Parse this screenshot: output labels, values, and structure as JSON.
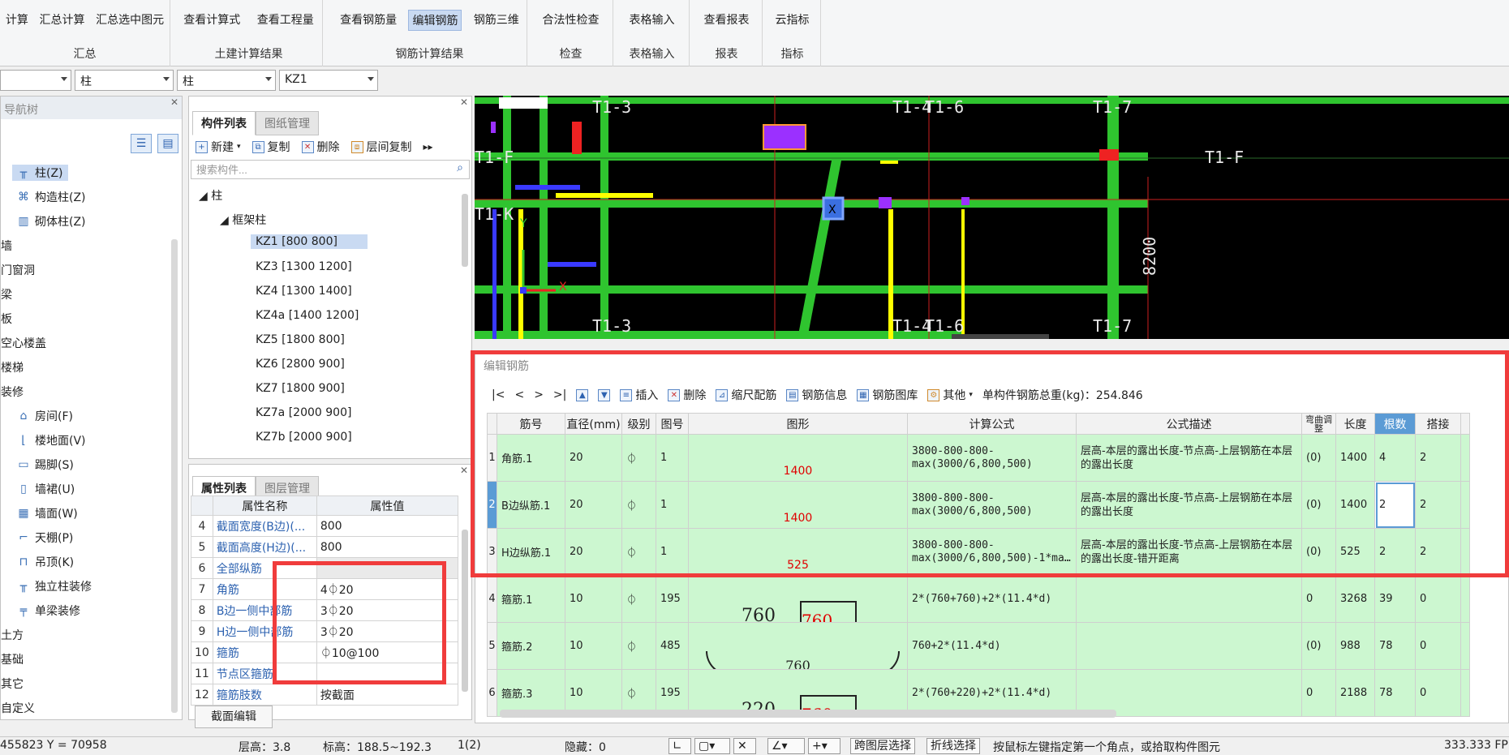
{
  "ribbon": {
    "groups": [
      {
        "label": "汇总",
        "buttons": [
          "计算",
          "汇总计算",
          "汇总选中图元"
        ]
      },
      {
        "label": "土建计算结果",
        "buttons": [
          "查看计算式",
          "查看工程量"
        ]
      },
      {
        "label": "钢筋计算结果",
        "buttons": [
          "查看钢筋量",
          "编辑钢筋",
          "钢筋三维"
        ]
      },
      {
        "label": "检查",
        "buttons": [
          "合法性检查"
        ]
      },
      {
        "label": "表格输入",
        "buttons": [
          "表格输入"
        ]
      },
      {
        "label": "报表",
        "buttons": [
          "查看报表"
        ]
      },
      {
        "label": "指标",
        "buttons": [
          "云指标"
        ]
      }
    ],
    "active_button": "编辑钢筋"
  },
  "selectors": [
    "柱",
    "柱",
    "KZ1"
  ],
  "nav": {
    "title": "导航树",
    "items": [
      "柱(Z)",
      "构造柱(Z)",
      "砌体柱(Z)",
      "墙",
      "门窗洞",
      "梁",
      "板",
      "空心楼盖",
      "楼梯",
      "装修",
      "房间(F)",
      "楼地面(V)",
      "踢脚(S)",
      "墙裙(U)",
      "墙面(W)",
      "天棚(P)",
      "吊顶(K)",
      "独立柱装修",
      "单梁装修",
      "土方",
      "基础",
      "其它",
      "自定义"
    ]
  },
  "components": {
    "tabs": [
      "构件列表",
      "图纸管理"
    ],
    "toolbar": [
      "新建",
      "复制",
      "删除",
      "层间复制"
    ],
    "search_placeholder": "搜索构件...",
    "root": "柱",
    "group": "框架柱",
    "items": [
      "KZ1 [800 800]",
      "KZ3 [1300 1200]",
      "KZ4 [1300 1400]",
      "KZ4a [1400 1200]",
      "KZ5 [1800 800]",
      "KZ6 [2800 900]",
      "KZ7 [1800 900]",
      "KZ7a [2000 900]",
      "KZ7b [2000 900]"
    ]
  },
  "properties": {
    "tabs": [
      "属性列表",
      "图层管理"
    ],
    "headers": [
      "属性名称",
      "属性值"
    ],
    "rows": [
      {
        "idx": "4",
        "name": "截面宽度(B边)(...",
        "value": "800"
      },
      {
        "idx": "5",
        "name": "截面高度(H边)(...",
        "value": "800"
      },
      {
        "idx": "6",
        "name": "全部纵筋",
        "value": ""
      },
      {
        "idx": "7",
        "name": "角筋",
        "value": "4⏀20"
      },
      {
        "idx": "8",
        "name": "B边一侧中部筋",
        "value": "3⏀20"
      },
      {
        "idx": "9",
        "name": "H边一侧中部筋",
        "value": "3⏀20"
      },
      {
        "idx": "10",
        "name": "箍筋",
        "value": "⏀10@100"
      },
      {
        "idx": "11",
        "name": "节点区箍筋",
        "value": ""
      },
      {
        "idx": "12",
        "name": "箍筋肢数",
        "value": "按截面"
      }
    ],
    "edit_button": "截面编辑"
  },
  "cad": {
    "labels": [
      "T1-3",
      "T1-4",
      "T1-6",
      "T1-7",
      "T1-F",
      "T1-F",
      "T1-K",
      "T1-3",
      "T1-4",
      "T1-6",
      "T1-7",
      "8200",
      "Y",
      "X"
    ]
  },
  "rebar": {
    "title": "编辑钢筋",
    "toolbar": [
      "|<",
      "<",
      ">",
      ">|",
      "插入",
      "删除",
      "缩尺配筋",
      "钢筋信息",
      "钢筋图库",
      "其他"
    ],
    "total_weight": "单构件钢筋总重(kg)：254.846",
    "headers": [
      "筋号",
      "直径(mm)",
      "级别",
      "图号",
      "图形",
      "计算公式",
      "公式描述",
      "弯曲调整",
      "长度",
      "根数",
      "搭接"
    ],
    "rows": [
      {
        "num": "1",
        "name": "角筋.1",
        "dia": "20",
        "grade": "⏀",
        "fig": "1",
        "shape": "1400",
        "formula1": "3800-800-800-",
        "formula2": "max(3000/6,800,500)",
        "desc": "层高-本层的露出长度-节点高-上层钢筋在本层的露出长度",
        "bend": "(0)",
        "length": "1400",
        "count": "4",
        "lap": "2"
      },
      {
        "num": "2",
        "name": "B边纵筋.1",
        "dia": "20",
        "grade": "⏀",
        "fig": "1",
        "shape": "1400",
        "formula1": "3800-800-800-",
        "formula2": "max(3000/6,800,500)",
        "desc": "层高-本层的露出长度-节点高-上层钢筋在本层的露出长度",
        "bend": "(0)",
        "length": "1400",
        "count": "2",
        "lap": "2"
      },
      {
        "num": "3",
        "name": "H边纵筋.1",
        "dia": "20",
        "grade": "⏀",
        "fig": "1",
        "shape": "525",
        "formula1": "3800-800-800-",
        "formula2": "max(3000/6,800,500)-1*ma…",
        "desc": "层高-本层的露出长度-节点高-上层钢筋在本层的露出长度-错开距离",
        "bend": "(0)",
        "length": "525",
        "count": "2",
        "lap": "2"
      },
      {
        "num": "4",
        "name": "箍筋.1",
        "dia": "10",
        "grade": "⏀",
        "fig": "195",
        "shape_a": "760",
        "shape_b": "760",
        "formula1": "2*(760+760)+2*(11.4*d)",
        "formula2": "",
        "desc": "",
        "bend": "0",
        "length": "3268",
        "count": "39",
        "lap": "0"
      },
      {
        "num": "5",
        "name": "箍筋.2",
        "dia": "10",
        "grade": "⏀",
        "fig": "485",
        "shape_a": "760",
        "formula1": "760+2*(11.4*d)",
        "formula2": "",
        "desc": "",
        "bend": "(0)",
        "length": "988",
        "count": "78",
        "lap": "0"
      },
      {
        "num": "6",
        "name": "箍筋.3",
        "dia": "10",
        "grade": "⏀",
        "fig": "195",
        "shape_a": "220",
        "shape_b": "760",
        "formula1": "2*(760+220)+2*(11.4*d)",
        "formula2": "",
        "desc": "",
        "bend": "0",
        "length": "2188",
        "count": "78",
        "lap": "0"
      }
    ]
  },
  "status": {
    "coords": "455823 Y = 70958",
    "floor_height": "层高：3.8",
    "elevation": "标高：188.5~192.3",
    "page": "1(2)",
    "hidden": "隐藏：0",
    "btn_cross_layer": "跨图层选择",
    "btn_polyline": "折线选择",
    "hint": "按鼠标左键指定第一个角点，或拾取构件图元",
    "fps": "333.333 FP"
  },
  "colors": {
    "highlight_red": "#f03c3c",
    "row_green": "#ccf7d0",
    "accent_blue": "#5b9bd5"
  }
}
